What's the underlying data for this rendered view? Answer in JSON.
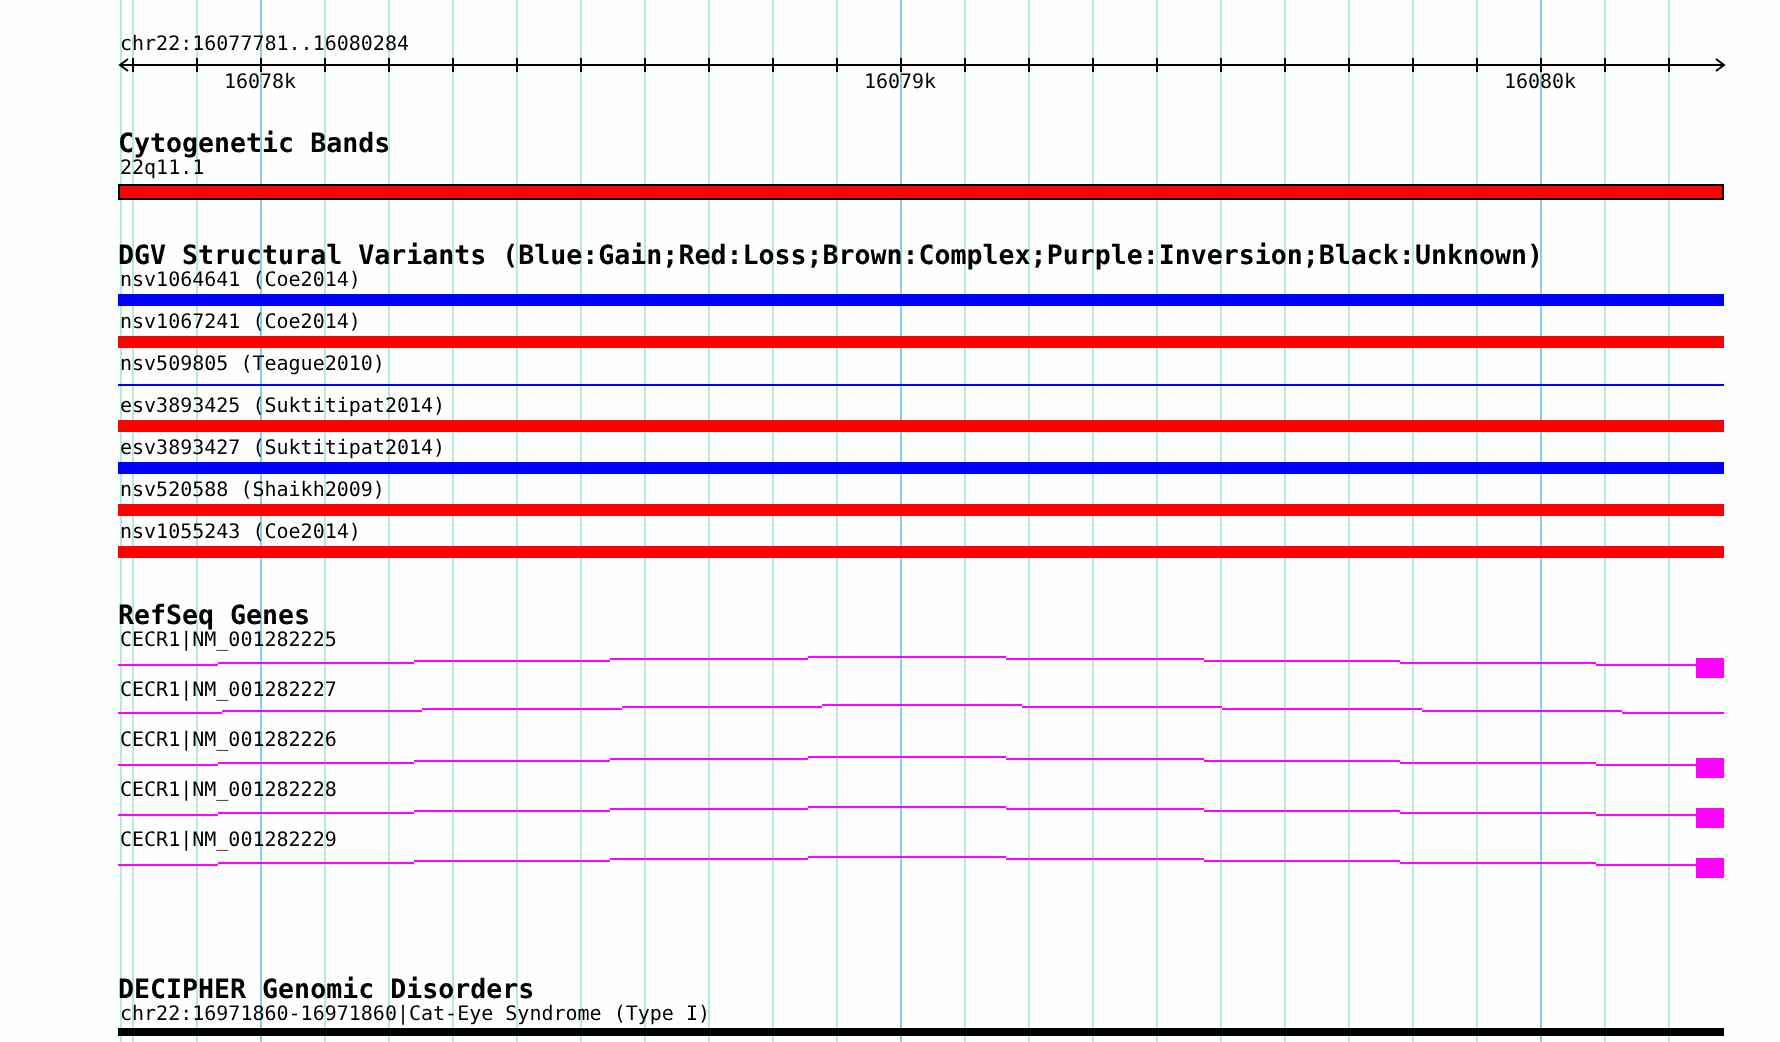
{
  "ruler": {
    "location": "chr22:16077781..16080284",
    "tick_labels": [
      "16078k",
      "16079k",
      "16080k"
    ]
  },
  "tracks": [
    {
      "kind": "bands",
      "title": "Cytogenetic Bands",
      "items": [
        {
          "label": "22q11.1",
          "kind": "bar",
          "color": "#ff0000"
        }
      ]
    },
    {
      "kind": "variants",
      "title": "DGV Structural Variants (Blue:Gain;Red:Loss;Brown:Complex;Purple:Inversion;Black:Unknown)",
      "items": [
        {
          "label": "nsv1064641 (Coe2014)",
          "kind": "bar",
          "color": "#0000ff"
        },
        {
          "label": "nsv1067241 (Coe2014)",
          "kind": "bar",
          "color": "#ff0000"
        },
        {
          "label": "nsv509805 (Teague2010)",
          "kind": "line",
          "color": "#0000ff"
        },
        {
          "label": "esv3893425 (Suktitipat2014)",
          "kind": "bar",
          "color": "#ff0000"
        },
        {
          "label": "esv3893427 (Suktitipat2014)",
          "kind": "bar",
          "color": "#0000ff"
        },
        {
          "label": "nsv520588 (Shaikh2009)",
          "kind": "bar",
          "color": "#ff0000"
        },
        {
          "label": "nsv1055243 (Coe2014)",
          "kind": "bar",
          "color": "#ff0000"
        }
      ]
    },
    {
      "kind": "genes",
      "title": "RefSeq Genes",
      "items": [
        {
          "label": "CECR1|NM_001282225",
          "end_exon": true
        },
        {
          "label": "CECR1|NM_001282227",
          "end_exon": false
        },
        {
          "label": "CECR1|NM_001282226",
          "end_exon": true
        },
        {
          "label": "CECR1|NM_001282228",
          "end_exon": true
        },
        {
          "label": "CECR1|NM_001282229",
          "end_exon": true
        }
      ]
    },
    {
      "kind": "disorders",
      "title": "DECIPHER Genomic Disorders",
      "items": [
        {
          "label": "chr22:16971860-16971860|Cat-Eye Syndrome (Type I)",
          "kind": "bar",
          "color": "#000000"
        }
      ]
    }
  ]
}
